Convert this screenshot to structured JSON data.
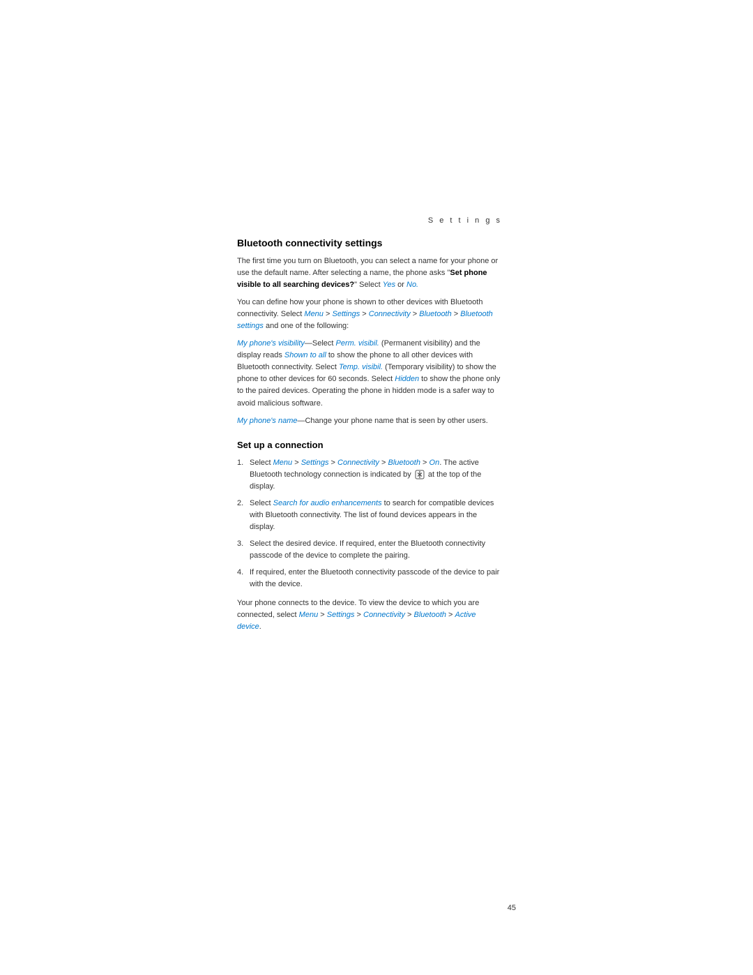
{
  "header": {
    "settings_label": "S e t t i n g s"
  },
  "section1": {
    "title": "Bluetooth connectivity settings",
    "para1": "The first time you turn on Bluetooth, you can select a name for your phone or use the default name. After selecting a name, the phone asks \"",
    "para1_bold": "Set phone visible to all searching devices?",
    "para1_end": "\" Select ",
    "yes_link": "Yes",
    "or_text": " or ",
    "no_link": "No.",
    "para2_start": "You can define how your phone is shown to other devices with Bluetooth connectivity. Select ",
    "menu_link": "Menu",
    "gt1": " > ",
    "settings_link": "Settings",
    "gt2": " > ",
    "connectivity_link": "Connectivity",
    "gt3": " > ",
    "bluetooth_link": "Bluetooth",
    "gt4": " > ",
    "bt_settings_link": "Bluetooth settings",
    "para2_end": " and one of the following:",
    "visibility_link": "My phone's visibility",
    "dash1": "—Select ",
    "perm_link": "Perm. visibil.",
    "perm_desc": " (Permanent visibility) and the display reads ",
    "shown_link": "Shown to all",
    "shown_desc": " to show the phone to all other devices with Bluetooth connectivity. Select ",
    "temp_link": "Temp. visibil.",
    "temp_desc": " (Temporary visibility) to show the phone to other devices for 60 seconds. Select ",
    "hidden_link": "Hidden",
    "hidden_desc": " to show the phone only to the paired devices. Operating the phone in hidden mode is a safer way to avoid malicious software.",
    "name_link": "My phone's name",
    "name_desc": "—Change your phone name that is seen by other users."
  },
  "section2": {
    "title": "Set up a connection",
    "items": [
      {
        "number": "1.",
        "text_start": "Select ",
        "menu": "Menu",
        "gt1": " > ",
        "settings": "Settings",
        "gt2": " > ",
        "connectivity": "Connectivity",
        "gt3": " > ",
        "bluetooth": "Bluetooth",
        "gt4": " > ",
        "on": "On",
        "text_end": ". The active Bluetooth technology connection is indicated by ",
        "icon_label": "[bt-icon]",
        "text_end2": " at the top of the display."
      },
      {
        "number": "2.",
        "text_start": "Select ",
        "search_link": "Search for audio enhancements",
        "text_end": " to search for compatible devices with Bluetooth connectivity. The list of found devices appears in the display."
      },
      {
        "number": "3.",
        "text": "Select the desired device. If required, enter the Bluetooth connectivity passcode of the device to complete the pairing."
      },
      {
        "number": "4.",
        "text": "If required, enter the Bluetooth connectivity passcode of the device to pair with the device."
      }
    ],
    "footer_start": "Your phone connects to the device. To view the device to which you are connected, select ",
    "footer_menu": "Menu",
    "footer_gt1": " > ",
    "footer_settings": "Settings",
    "footer_gt2": " > ",
    "footer_connectivity": "Connectivity",
    "footer_gt3": " > ",
    "footer_bluetooth": "Bluetooth",
    "footer_gt4": " > ",
    "footer_active": "Active device",
    "footer_end": "."
  },
  "page_number": "45"
}
